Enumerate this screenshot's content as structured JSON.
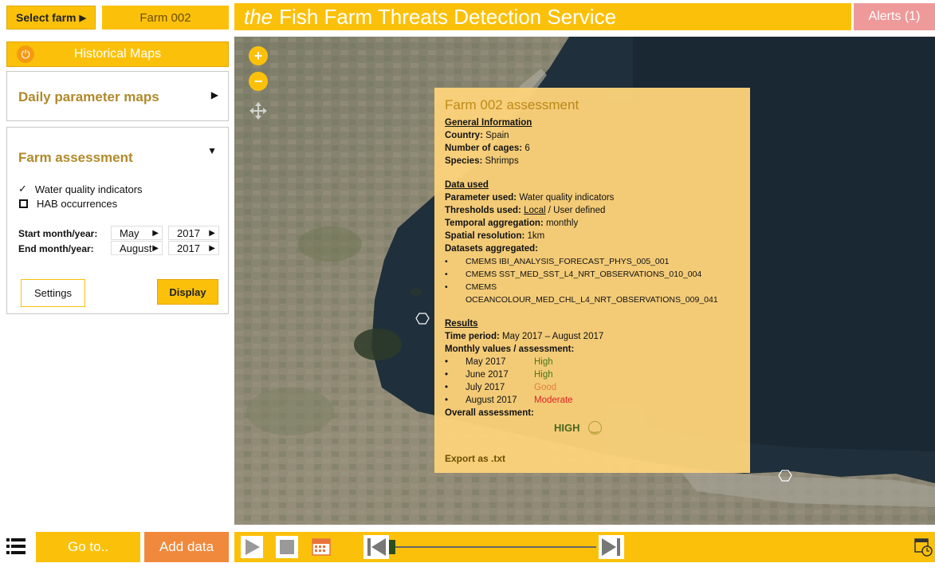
{
  "header": {
    "select_farm_label": "Select farm",
    "farm_name": "Farm 002",
    "title_prefix": "the",
    "title_main": "Fish Farm Threats Detection Service",
    "alerts_label": "Alerts (1)"
  },
  "sidebar": {
    "historical_maps": "Historical Maps",
    "daily_parameter_maps": "Daily parameter maps",
    "farm_assessment": "Farm assessment",
    "options": [
      {
        "label": "Water quality indicators",
        "checked": true
      },
      {
        "label": "HAB occurrences",
        "checked": false
      }
    ],
    "start_label": "Start month/year:",
    "start_month": "May",
    "start_year": "2017",
    "end_label": "End month/year:",
    "end_month": "August",
    "end_year": "2017",
    "settings_label": "Settings",
    "display_label": "Display"
  },
  "popup": {
    "title": "Farm 002 assessment",
    "general_heading": "General Information",
    "country_label": "Country:",
    "country": "Spain",
    "cages_label": "Number of cages:",
    "cages": "6",
    "species_label": "Species:",
    "species": "Shrimps",
    "data_heading": "Data used",
    "parameter_label": "Parameter used:",
    "parameter": "Water quality indicators",
    "thresholds_label": "Thresholds used:",
    "thresholds_local": "Local",
    "thresholds_rest": "/ User defined",
    "temporal_label": "Temporal aggregation:",
    "temporal": "monthly",
    "spatial_label": "Spatial resolution:",
    "spatial": "1km",
    "datasets_label": "Datasets aggregated:",
    "datasets": [
      "CMEMS IBI_ANALYSIS_FORECAST_PHYS_005_001",
      "CMEMS SST_MED_SST_L4_NRT_OBSERVATIONS_010_004",
      "CMEMS OCEANCOLOUR_MED_CHL_L4_NRT_OBSERVATIONS_009_041"
    ],
    "results_heading": "Results",
    "period_label": "Time period:",
    "period": "May 2017 – August 2017",
    "monthly_label": "Monthly values / assessment:",
    "monthly": [
      {
        "month": "May 2017",
        "status": "High",
        "color": "#4b7a1c"
      },
      {
        "month": "June 2017",
        "status": "High",
        "color": "#4b7a1c"
      },
      {
        "month": "July 2017",
        "status": "Good",
        "color": "#e8843a"
      },
      {
        "month": "August 2017",
        "status": "Moderate",
        "color": "#e8231f"
      }
    ],
    "overall_label": "Overall assessment:",
    "overall_value": "HIGH",
    "export_label": "Export as .txt"
  },
  "footer": {
    "goto_label": "Go to..",
    "add_data_label": "Add data"
  },
  "colors": {
    "accent": "#fbc10a",
    "alert": "#ee9a9a",
    "add_data": "#f0893c",
    "popup_bg": "#fcd27a"
  }
}
